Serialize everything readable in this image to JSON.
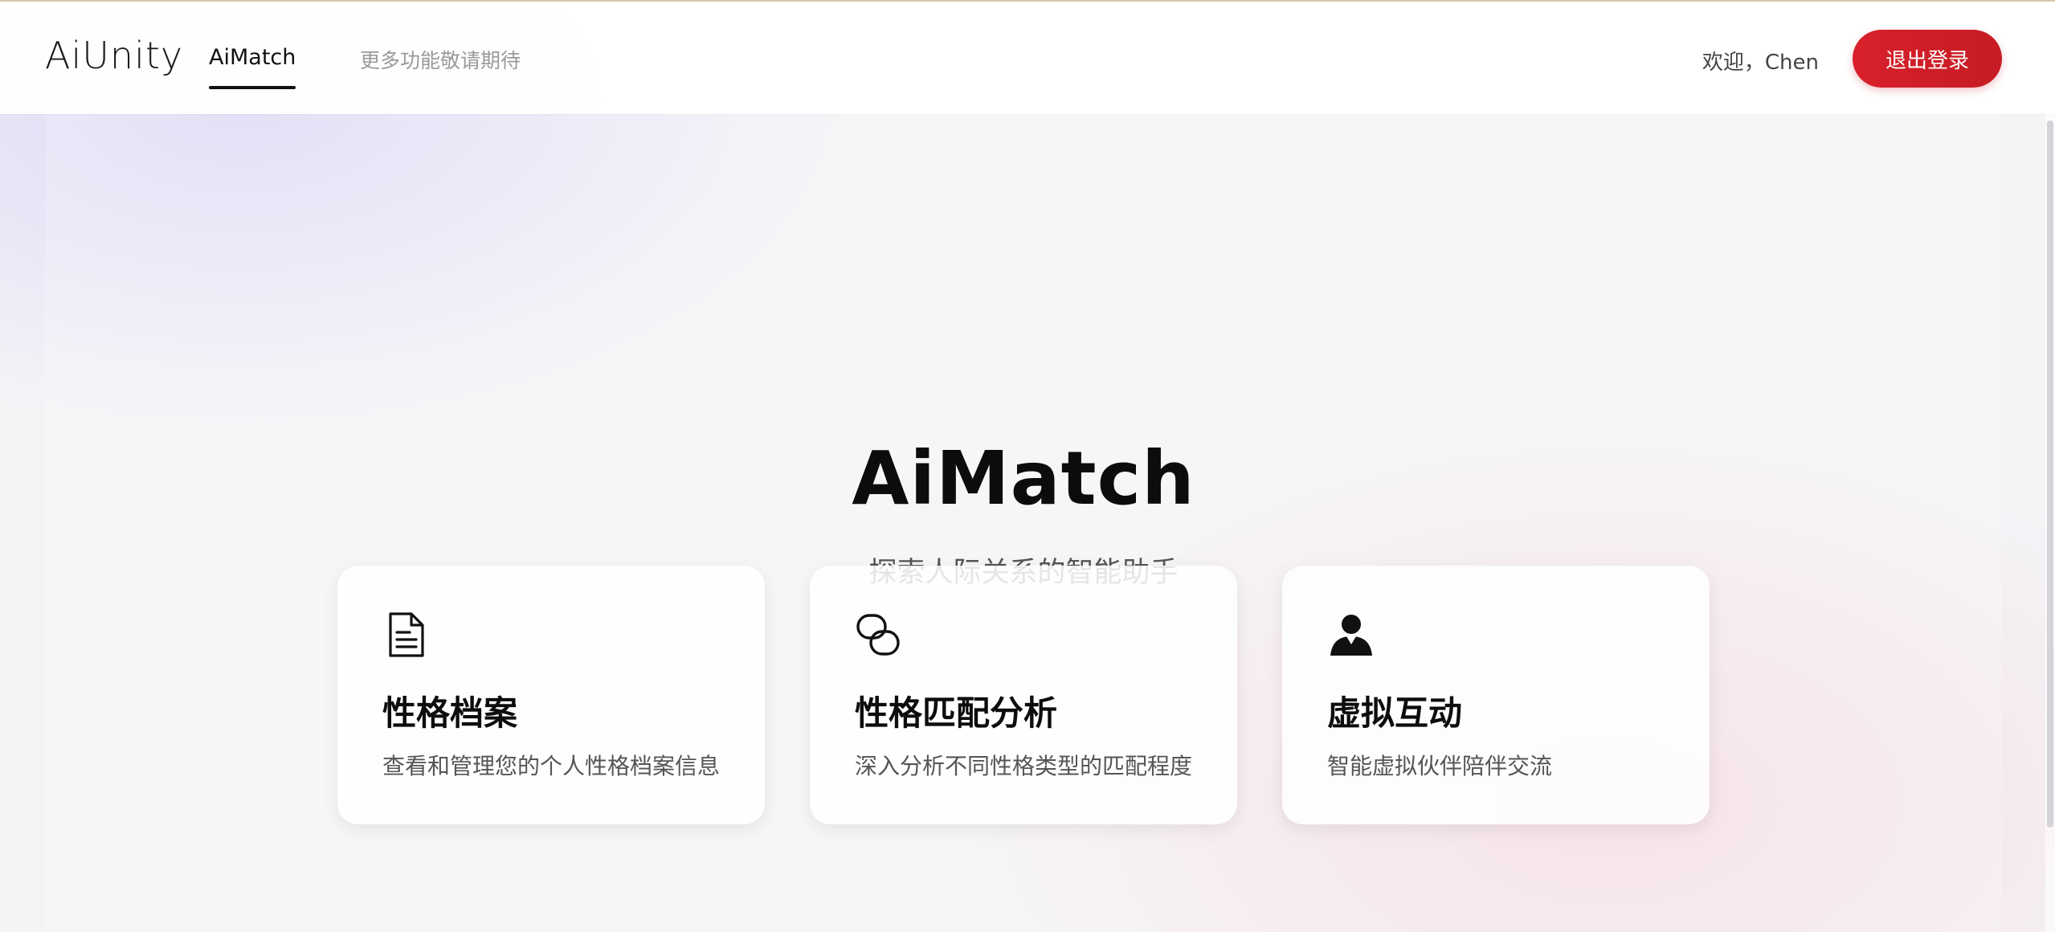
{
  "header": {
    "logo": "AiUnity",
    "tabs": [
      {
        "label": "AiMatch",
        "active": true
      },
      {
        "label": "更多功能敬请期待",
        "active": false
      }
    ],
    "welcome": "欢迎，Chen",
    "logout_label": "退出登录"
  },
  "hero": {
    "title": "AiMatch",
    "subtitle": "探索人际关系的智能助手"
  },
  "cards": [
    {
      "icon": "document-icon",
      "title": "性格档案",
      "desc": "查看和管理您的个人性格档案信息"
    },
    {
      "icon": "link-icon",
      "title": "性格匹配分析",
      "desc": "深入分析不同性格类型的匹配程度"
    },
    {
      "icon": "person-icon",
      "title": "虚拟互动",
      "desc": "智能虚拟伙伴陪伴交流"
    }
  ],
  "colors": {
    "accent": "#d8202b",
    "title": "#0c0c0c",
    "muted": "#9a9a9a"
  }
}
